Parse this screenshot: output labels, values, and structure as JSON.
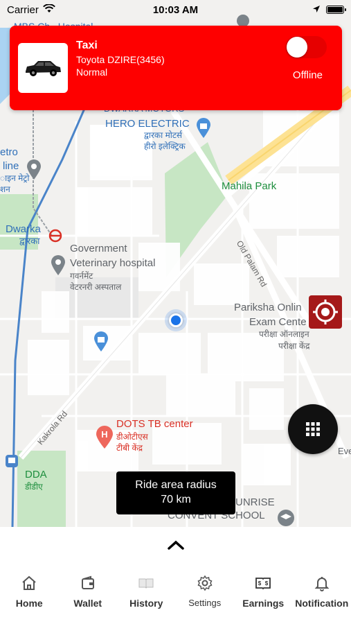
{
  "status_bar": {
    "carrier": "Carrier",
    "time": "10:03 AM"
  },
  "driver_card": {
    "vehicle_type": "Taxi",
    "vehicle_model": "Toyota DZIRE(3456)",
    "vehicle_class": "Normal",
    "status": "Offline",
    "online": false,
    "background_color": "#fe0000"
  },
  "map_labels": {
    "mbs": "MBS Ch...Hospital",
    "dwarka_motors": "DWARKA MOTORS",
    "hero_electric": "HERO ELECTRIC",
    "hero_electric_hi_1": "द्वारका मोटर्स",
    "hero_electric_hi_2": "हीरो इलेक्ट्रिक",
    "metro_line_1": "etro",
    "metro_line_2": "line",
    "metro_line_hi_1": "ाइन मेट्रो",
    "metro_line_hi_2": "शन",
    "mahila_park": "Mahila Park",
    "dwarka": "Dwarka",
    "dwarka_hi": "द्वारका",
    "old_palam_rd": "Old Palam Rd",
    "govt_vet_1": "Government",
    "govt_vet_2": "Veterinary hospital",
    "govt_vet_hi_1": "गवर्नमेंट",
    "govt_vet_hi_2": "वेटरनरी अस्पताल",
    "pariksha_1": "Pariksha Onlin",
    "pariksha_2": "Exam Cente",
    "pariksha_hi_1": "परीक्षा ऑनलाइन",
    "pariksha_hi_2": "परीक्षा केंद्र",
    "kakrola_rd": "Kakrola Rd",
    "dots_tb": "DOTS TB center",
    "dots_tb_hi_1": "डीओटीएस",
    "dots_tb_hi_2": "टीबी केंद्र",
    "dda": "DDA",
    "dda_hi": "डीडीए",
    "eve": "Eve",
    "sunrise_1": "UNRISE",
    "sunrise_2": "CONVENT SCHOOL"
  },
  "ride_radius": {
    "label": "Ride area radius",
    "value": "70 km"
  },
  "tabs": [
    {
      "label": "Home",
      "icon": "home-icon"
    },
    {
      "label": "Wallet",
      "icon": "wallet-icon"
    },
    {
      "label": "History",
      "icon": "book-icon"
    },
    {
      "label": "Settings",
      "icon": "gear-icon"
    },
    {
      "label": "Earnings",
      "icon": "earnings-icon"
    },
    {
      "label": "Notification",
      "icon": "bell-icon"
    }
  ],
  "colors": {
    "accent": "#fe0000",
    "target_button": "#a51919",
    "location_dot": "#1a73e8"
  }
}
